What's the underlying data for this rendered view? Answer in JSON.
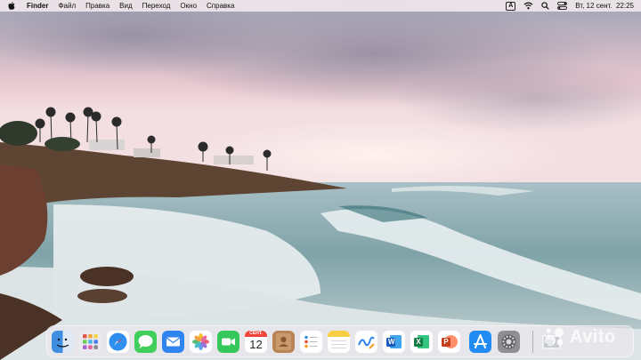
{
  "menubar": {
    "app_name": "Finder",
    "menus": [
      "Файл",
      "Правка",
      "Вид",
      "Переход",
      "Окно",
      "Справка"
    ],
    "input_source": "A",
    "datetime": "Вт, 12 сент.  22:25"
  },
  "dock": {
    "calendar_month": "СЕНТ.",
    "calendar_day": "12",
    "apps": [
      {
        "name": "finder-icon"
      },
      {
        "name": "launchpad-icon"
      },
      {
        "name": "safari-icon"
      },
      {
        "name": "messages-icon"
      },
      {
        "name": "mail-icon"
      },
      {
        "name": "photos-icon"
      },
      {
        "name": "facetime-icon"
      },
      {
        "name": "calendar-icon"
      },
      {
        "name": "contacts-icon"
      },
      {
        "name": "reminders-icon"
      },
      {
        "name": "notes-icon"
      },
      {
        "name": "freeform-icon"
      },
      {
        "name": "word-icon"
      },
      {
        "name": "excel-icon"
      },
      {
        "name": "powerpoint-icon"
      },
      {
        "name": "app-store-icon"
      },
      {
        "name": "system-settings-icon"
      },
      {
        "name": "downloads-stack-icon"
      }
    ],
    "office_letters": {
      "word": "W",
      "excel": "X",
      "powerpoint": "P"
    }
  },
  "watermark": {
    "text": "Avito"
  },
  "colors": {
    "sky_top": "#b9bcc8",
    "sky_pink": "#e7c4cc",
    "sea": "#7fa3a8",
    "foam": "#e9eef0",
    "cliff": "#5a3a2a"
  }
}
